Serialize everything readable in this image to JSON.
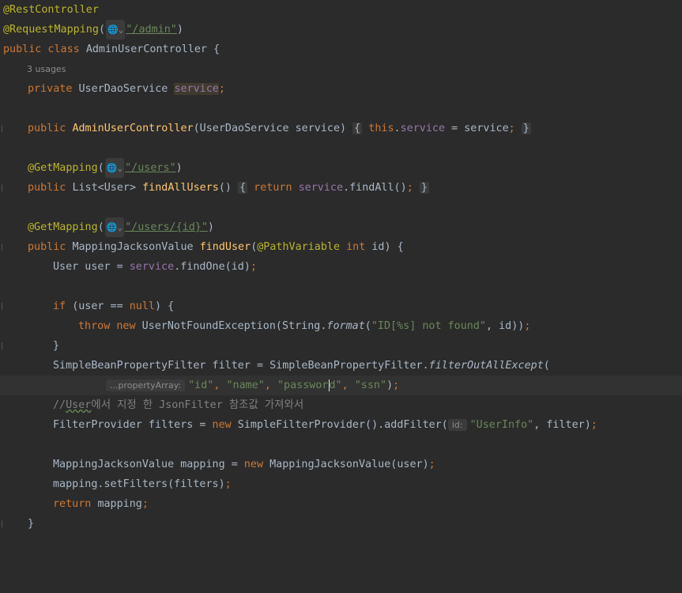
{
  "editor": {
    "l1": {
      "ann": "@RestController"
    },
    "l2": {
      "ann": "@RequestMapping",
      "open": "(",
      "url": "\"/admin\"",
      "close": ")"
    },
    "l3": {
      "kw": "public class ",
      "name": "AdminUserController {"
    },
    "l4": {
      "usages": "3 usages"
    },
    "l5": {
      "kw": "private ",
      "type": "UserDaoService ",
      "field": "service",
      "semi": ";"
    },
    "l7": {
      "kw": "public ",
      "fn": "AdminUserController",
      "params": "(UserDaoService service) ",
      "ob": "{",
      "this": " this",
      "dot": ".",
      "field": "service",
      "rest": " = service",
      "semi": ";",
      "cb": "}"
    },
    "l9": {
      "ann": "@GetMapping",
      "open": "(",
      "url": "\"/users\"",
      "close": ")"
    },
    "l10": {
      "kw": "public ",
      "type": "List<User> ",
      "fn": "findAllUsers",
      "paren": "() ",
      "ob": "{",
      "ret": " return ",
      "field": "service",
      "rest": ".findAll()",
      "semi": ";",
      "cb": "}"
    },
    "l12": {
      "ann": "@GetMapping",
      "open": "(",
      "url": "\"/users/{id}\"",
      "close": ")"
    },
    "l13": {
      "kw": "public ",
      "type": "MappingJacksonValue ",
      "fn": "findUser",
      "p1": "(",
      "ann": "@PathVariable ",
      "kw2": "int ",
      "rest": "id) {"
    },
    "l14": {
      "pre": "User user = ",
      "field": "service",
      "rest": ".findOne(id)",
      "semi": ";"
    },
    "l16": {
      "kw": "if ",
      "p1": "(user == ",
      "null": "null",
      "rest": ") {"
    },
    "l17": {
      "kw": "throw new ",
      "pre": "UserNotFoundException(String.",
      "fmt": "format",
      "p": "(",
      "str": "\"ID[%s] not found\"",
      "rest": ", id))",
      "semi": ";"
    },
    "l18": {
      "text": "}"
    },
    "l19": {
      "pre": "SimpleBeanPropertyFilter filter = SimpleBeanPropertyFilter.",
      "fn": "filterOutAllExcept",
      "rest": "("
    },
    "l20": {
      "hint": "...propertyArray:",
      "s1": "\"id\"",
      "c1": ", ",
      "s2": "\"name\"",
      "c2": ", ",
      "s3a": "\"passwor",
      "s3b": "d\"",
      "c3": ", ",
      "s4": "\"ssn\"",
      "rest": ")",
      "semi": ";"
    },
    "l21": {
      "slashes": "//",
      "user": "User",
      "rest": "에서 지정 한 JsonFilter 참조값 가져와서"
    },
    "l22": {
      "pre": "FilterProvider filters = ",
      "kw": "new ",
      "mid": "SimpleFilterProvider().addFilter(",
      "hint": "id:",
      "str": "\"UserInfo\"",
      "rest": ", filter)",
      "semi": ";"
    },
    "l24": {
      "pre": "MappingJacksonValue mapping = ",
      "kw": "new ",
      "rest": "MappingJacksonValue(user)",
      "semi": ";"
    },
    "l25": {
      "pre": "mapping.setFilters(filters)",
      "semi": ";"
    },
    "l26": {
      "kw": "return ",
      "rest": "mapping",
      "semi": ";"
    },
    "l27": {
      "text": "}"
    },
    "globe": "🌐⌄"
  }
}
